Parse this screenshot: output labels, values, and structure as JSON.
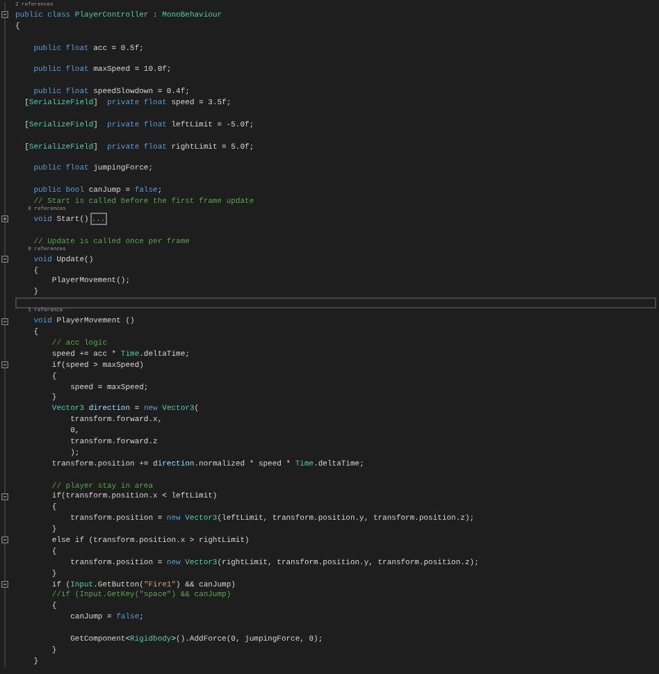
{
  "editor": {
    "lines": [
      {
        "kind": "codelens",
        "text": "2 references"
      },
      {
        "kind": "code",
        "expanded": true,
        "tokens": [
          {
            "kind": "keyword",
            "text": "public class "
          },
          {
            "kind": "type",
            "text": "PlayerController"
          },
          {
            "kind": "plain",
            "text": " : "
          },
          {
            "kind": "type",
            "text": "MonoBehaviour"
          }
        ]
      },
      {
        "kind": "code",
        "tokens": [
          {
            "kind": "plain",
            "text": "{"
          }
        ]
      },
      {
        "kind": "blank"
      },
      {
        "kind": "code",
        "tokens": [
          {
            "kind": "keyword",
            "text": "    public float "
          },
          {
            "kind": "plain",
            "text": "acc = 0.5f;"
          }
        ]
      },
      {
        "kind": "blank"
      },
      {
        "kind": "code",
        "tokens": [
          {
            "kind": "keyword",
            "text": "    public float "
          },
          {
            "kind": "plain",
            "text": "maxSpeed = 10.0f;"
          }
        ]
      },
      {
        "kind": "blank"
      },
      {
        "kind": "code",
        "tokens": [
          {
            "kind": "keyword",
            "text": "    public float "
          },
          {
            "kind": "plain",
            "text": "speedSlowdown = 0.4f;"
          }
        ]
      },
      {
        "kind": "code",
        "tokens": [
          {
            "kind": "plain",
            "text": "  ["
          },
          {
            "kind": "type",
            "text": "SerializeField"
          },
          {
            "kind": "plain",
            "text": "]  "
          },
          {
            "kind": "keyword",
            "text": "private float "
          },
          {
            "kind": "plain",
            "text": "speed = 3.5f;"
          }
        ]
      },
      {
        "kind": "blank"
      },
      {
        "kind": "code",
        "tokens": [
          {
            "kind": "plain",
            "text": "  ["
          },
          {
            "kind": "type",
            "text": "SerializeField"
          },
          {
            "kind": "plain",
            "text": "]  "
          },
          {
            "kind": "keyword",
            "text": "private float "
          },
          {
            "kind": "plain",
            "text": "leftLimit = -5.0f;"
          }
        ]
      },
      {
        "kind": "blank"
      },
      {
        "kind": "code",
        "tokens": [
          {
            "kind": "plain",
            "text": "  ["
          },
          {
            "kind": "type",
            "text": "SerializeField"
          },
          {
            "kind": "plain",
            "text": "]  "
          },
          {
            "kind": "keyword",
            "text": "private float "
          },
          {
            "kind": "plain",
            "text": "rightLimit = 5.0f;"
          }
        ]
      },
      {
        "kind": "blank"
      },
      {
        "kind": "code",
        "tokens": [
          {
            "kind": "keyword",
            "text": "    public float "
          },
          {
            "kind": "plain",
            "text": "jumpingForce;"
          }
        ]
      },
      {
        "kind": "blank"
      },
      {
        "kind": "code",
        "tokens": [
          {
            "kind": "keyword",
            "text": "    public bool "
          },
          {
            "kind": "plain",
            "text": "canJump = "
          },
          {
            "kind": "keyword",
            "text": "false"
          },
          {
            "kind": "plain",
            "text": ";"
          }
        ]
      },
      {
        "kind": "code",
        "tokens": [
          {
            "kind": "comment",
            "text": "    // Start is called before the first frame update"
          }
        ]
      },
      {
        "kind": "codelens",
        "text": "    0 references"
      },
      {
        "kind": "code",
        "expanded": false,
        "tokens": [
          {
            "kind": "keyword",
            "text": "    void "
          },
          {
            "kind": "plain",
            "text": "Start()"
          },
          {
            "kind": "collapsed",
            "text": "..."
          }
        ]
      },
      {
        "kind": "blank"
      },
      {
        "kind": "code",
        "tokens": [
          {
            "kind": "comment",
            "text": "    // Update is called once per frame"
          }
        ]
      },
      {
        "kind": "codelens",
        "text": "    0 references"
      },
      {
        "kind": "code",
        "expanded": true,
        "tokens": [
          {
            "kind": "keyword",
            "text": "    void "
          },
          {
            "kind": "plain",
            "text": "Update()"
          }
        ]
      },
      {
        "kind": "code",
        "tokens": [
          {
            "kind": "plain",
            "text": "    {"
          }
        ]
      },
      {
        "kind": "code",
        "tokens": [
          {
            "kind": "plain",
            "text": "        PlayerMovement();"
          }
        ]
      },
      {
        "kind": "code",
        "tokens": [
          {
            "kind": "plain",
            "text": "    }"
          }
        ]
      },
      {
        "kind": "blank",
        "current": true
      },
      {
        "kind": "codelens",
        "text": "    1 reference"
      },
      {
        "kind": "code",
        "expanded": true,
        "tokens": [
          {
            "kind": "keyword",
            "text": "    void "
          },
          {
            "kind": "plain",
            "text": "PlayerMovement ()"
          }
        ]
      },
      {
        "kind": "code",
        "tokens": [
          {
            "kind": "plain",
            "text": "    {"
          }
        ]
      },
      {
        "kind": "code",
        "tokens": [
          {
            "kind": "comment",
            "text": "        // acc logic"
          }
        ]
      },
      {
        "kind": "code",
        "tokens": [
          {
            "kind": "plain",
            "text": "        speed += acc * "
          },
          {
            "kind": "type",
            "text": "Time"
          },
          {
            "kind": "plain",
            "text": ".deltaTime;"
          }
        ]
      },
      {
        "kind": "code",
        "expanded": true,
        "tokens": [
          {
            "kind": "plain",
            "text": "        if(speed > maxSpeed)"
          }
        ]
      },
      {
        "kind": "code",
        "tokens": [
          {
            "kind": "plain",
            "text": "        {"
          }
        ]
      },
      {
        "kind": "code",
        "tokens": [
          {
            "kind": "plain",
            "text": "            speed = maxSpeed;"
          }
        ]
      },
      {
        "kind": "code",
        "tokens": [
          {
            "kind": "plain",
            "text": "        }"
          }
        ]
      },
      {
        "kind": "code",
        "tokens": [
          {
            "kind": "type",
            "text": "        Vector3 "
          },
          {
            "kind": "variable",
            "text": "direction"
          },
          {
            "kind": "plain",
            "text": " = "
          },
          {
            "kind": "keyword",
            "text": "new "
          },
          {
            "kind": "type",
            "text": "Vector3"
          },
          {
            "kind": "plain",
            "text": "("
          }
        ]
      },
      {
        "kind": "code",
        "tokens": [
          {
            "kind": "plain",
            "text": "            transform.forward.x,"
          }
        ]
      },
      {
        "kind": "code",
        "tokens": [
          {
            "kind": "plain",
            "text": "            0,"
          }
        ]
      },
      {
        "kind": "code",
        "tokens": [
          {
            "kind": "plain",
            "text": "            transform.forward.z"
          }
        ]
      },
      {
        "kind": "code",
        "tokens": [
          {
            "kind": "plain",
            "text": "            );"
          }
        ]
      },
      {
        "kind": "code",
        "tokens": [
          {
            "kind": "plain",
            "text": "        transform.position += "
          },
          {
            "kind": "variable",
            "text": "direction"
          },
          {
            "kind": "plain",
            "text": ".normalized * speed * "
          },
          {
            "kind": "type",
            "text": "Time"
          },
          {
            "kind": "plain",
            "text": ".deltaTime;"
          }
        ]
      },
      {
        "kind": "blank"
      },
      {
        "kind": "code",
        "tokens": [
          {
            "kind": "comment",
            "text": "        // player stay in area"
          }
        ]
      },
      {
        "kind": "code",
        "expanded": true,
        "tokens": [
          {
            "kind": "plain",
            "text": "        if(transform.position.x < leftLimit)"
          }
        ]
      },
      {
        "kind": "code",
        "tokens": [
          {
            "kind": "plain",
            "text": "        {"
          }
        ]
      },
      {
        "kind": "code",
        "tokens": [
          {
            "kind": "plain",
            "text": "            transform.position = "
          },
          {
            "kind": "keyword",
            "text": "new "
          },
          {
            "kind": "type",
            "text": "Vector3"
          },
          {
            "kind": "plain",
            "text": "(leftLimit, transform.position.y, transform.position.z);"
          }
        ]
      },
      {
        "kind": "code",
        "tokens": [
          {
            "kind": "plain",
            "text": "        }"
          }
        ]
      },
      {
        "kind": "code",
        "expanded": true,
        "tokens": [
          {
            "kind": "plain",
            "text": "        else if (transform.position.x > rightLimit)"
          }
        ]
      },
      {
        "kind": "code",
        "tokens": [
          {
            "kind": "plain",
            "text": "        {"
          }
        ]
      },
      {
        "kind": "code",
        "tokens": [
          {
            "kind": "plain",
            "text": "            transform.position = "
          },
          {
            "kind": "keyword",
            "text": "new "
          },
          {
            "kind": "type",
            "text": "Vector3"
          },
          {
            "kind": "plain",
            "text": "(rightLimit, transform.position.y, transform.position.z);"
          }
        ]
      },
      {
        "kind": "code",
        "tokens": [
          {
            "kind": "plain",
            "text": "        }"
          }
        ]
      },
      {
        "kind": "code",
        "expanded": true,
        "tokens": [
          {
            "kind": "plain",
            "text": "        if ("
          },
          {
            "kind": "type",
            "text": "Input"
          },
          {
            "kind": "plain",
            "text": ".GetButton("
          },
          {
            "kind": "string",
            "text": "\"Fire1\""
          },
          {
            "kind": "plain",
            "text": ") && canJump)"
          }
        ]
      },
      {
        "kind": "code",
        "tokens": [
          {
            "kind": "comment",
            "text": "        //if (Input.GetKey(\"space\") && canJump)"
          }
        ]
      },
      {
        "kind": "code",
        "tokens": [
          {
            "kind": "plain",
            "text": "        {"
          }
        ]
      },
      {
        "kind": "code",
        "tokens": [
          {
            "kind": "plain",
            "text": "            canJump = "
          },
          {
            "kind": "keyword",
            "text": "false"
          },
          {
            "kind": "plain",
            "text": ";"
          }
        ]
      },
      {
        "kind": "blank"
      },
      {
        "kind": "code",
        "tokens": [
          {
            "kind": "plain",
            "text": "            GetComponent<"
          },
          {
            "kind": "type",
            "text": "Rigidbody"
          },
          {
            "kind": "plain",
            "text": ">().AddForce(0, jumpingForce, 0);"
          }
        ]
      },
      {
        "kind": "code",
        "tokens": [
          {
            "kind": "plain",
            "text": "        }"
          }
        ]
      },
      {
        "kind": "code",
        "tokens": [
          {
            "kind": "plain",
            "text": "    }"
          }
        ]
      }
    ]
  }
}
